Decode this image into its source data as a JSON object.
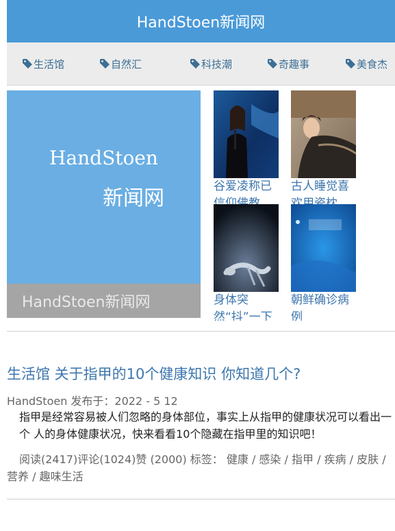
{
  "header": {
    "title": "HandStoen新闻网"
  },
  "nav": {
    "items": [
      {
        "label": "生活馆",
        "icon": "tag-icon"
      },
      {
        "label": "自然汇",
        "icon": "tag-icon"
      },
      {
        "label": "科技潮",
        "icon": "tag-icon"
      },
      {
        "label": "奇趣事",
        "icon": "tag-icon"
      },
      {
        "label": "美食杰",
        "icon": "tag-icon"
      }
    ]
  },
  "hero": {
    "logo_en": "HandStoen",
    "logo_cn": "新闻网",
    "caption": "HandStoen新闻网"
  },
  "thumbs": [
    {
      "title": "谷爱凌称已信仰佛教"
    },
    {
      "title": "古人睡觉喜欢用瓷枕"
    },
    {
      "title": "身体突然“抖”一下"
    },
    {
      "title": "朝鲜确诊病例"
    }
  ],
  "article": {
    "title": "生活馆 关于指甲的10个健康知识 你知道几个?",
    "meta": "HandStoen 发布于：2022 - 5 12",
    "summary": "指甲是经常容易被人们忽略的身体部位，事实上从指甲的健康状况可以看出一个 人的身体健康状况，快来看看10个隐藏在指甲里的知识吧！",
    "stats": "阅读(2417)评论(1024)赞 (2000) 标签： 健康 / 感染 / 指甲 / 疾病 / 皮肤 / 营养 / 趣味生活"
  },
  "colors": {
    "header_bg": "#4a9ad8",
    "link": "#3d76ad",
    "nav_bg": "#ececec"
  }
}
